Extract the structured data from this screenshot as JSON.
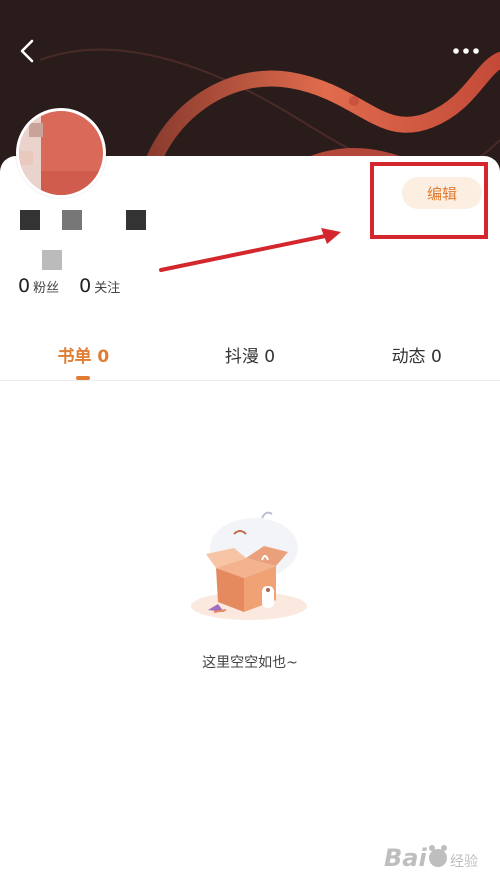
{
  "header": {
    "back_icon": "chevron-left-icon",
    "more_icon": "more-horizontal-icon"
  },
  "profile": {
    "edit_label": "编辑",
    "stats": [
      {
        "count": "0",
        "label": "粉丝"
      },
      {
        "count": "0",
        "label": "关注"
      }
    ]
  },
  "tabs": [
    {
      "label": "书单 0",
      "active": true
    },
    {
      "label": "抖漫 0",
      "active": false
    },
    {
      "label": "动态 0",
      "active": false
    }
  ],
  "empty_state": {
    "message": "这里空空如也~"
  },
  "colors": {
    "accent": "#e07d33",
    "header_bg": "#2a1c1b",
    "annotation_red": "#d3272d"
  }
}
